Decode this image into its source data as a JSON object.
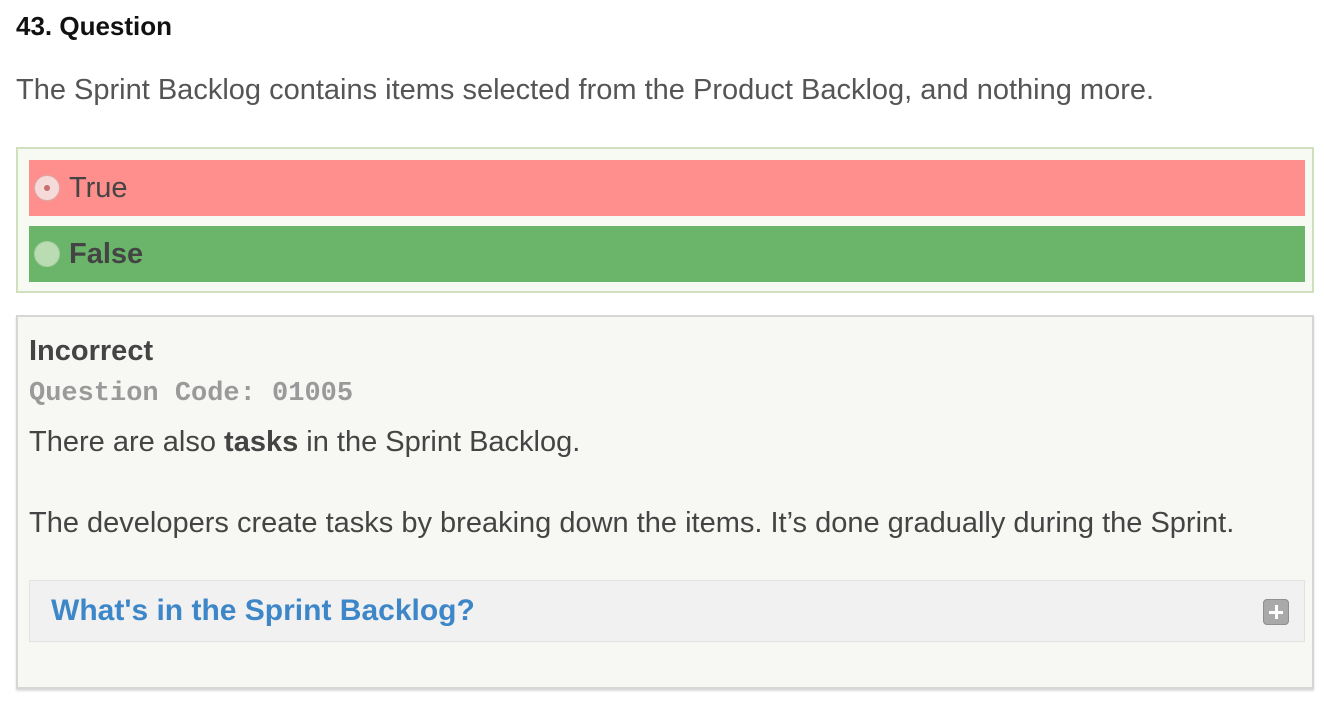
{
  "question": {
    "title": "43. Question",
    "text": "The Sprint Backlog contains items selected from the Product Backlog, and nothing more."
  },
  "answers": [
    {
      "label": "True",
      "selected": true,
      "status": "incorrect",
      "color": "#ff8f8c"
    },
    {
      "label": "False",
      "selected": false,
      "status": "correct",
      "color": "#6bb56b"
    }
  ],
  "feedback": {
    "status": "Incorrect",
    "code_label": "Question Code: 01005",
    "line1_before": "There are also ",
    "line1_bold": "tasks",
    "line1_after": " in the Sprint Backlog.",
    "line2": "The developers create tasks by breaking down the items. It’s done gradually during the Sprint.",
    "accordion": {
      "title": "What's in the Sprint Backlog?",
      "icon": "plus-icon",
      "expanded": false
    }
  },
  "colors": {
    "link": "#3d87c9",
    "incorrect": "#ff8f8c",
    "correct": "#6bb56b"
  }
}
